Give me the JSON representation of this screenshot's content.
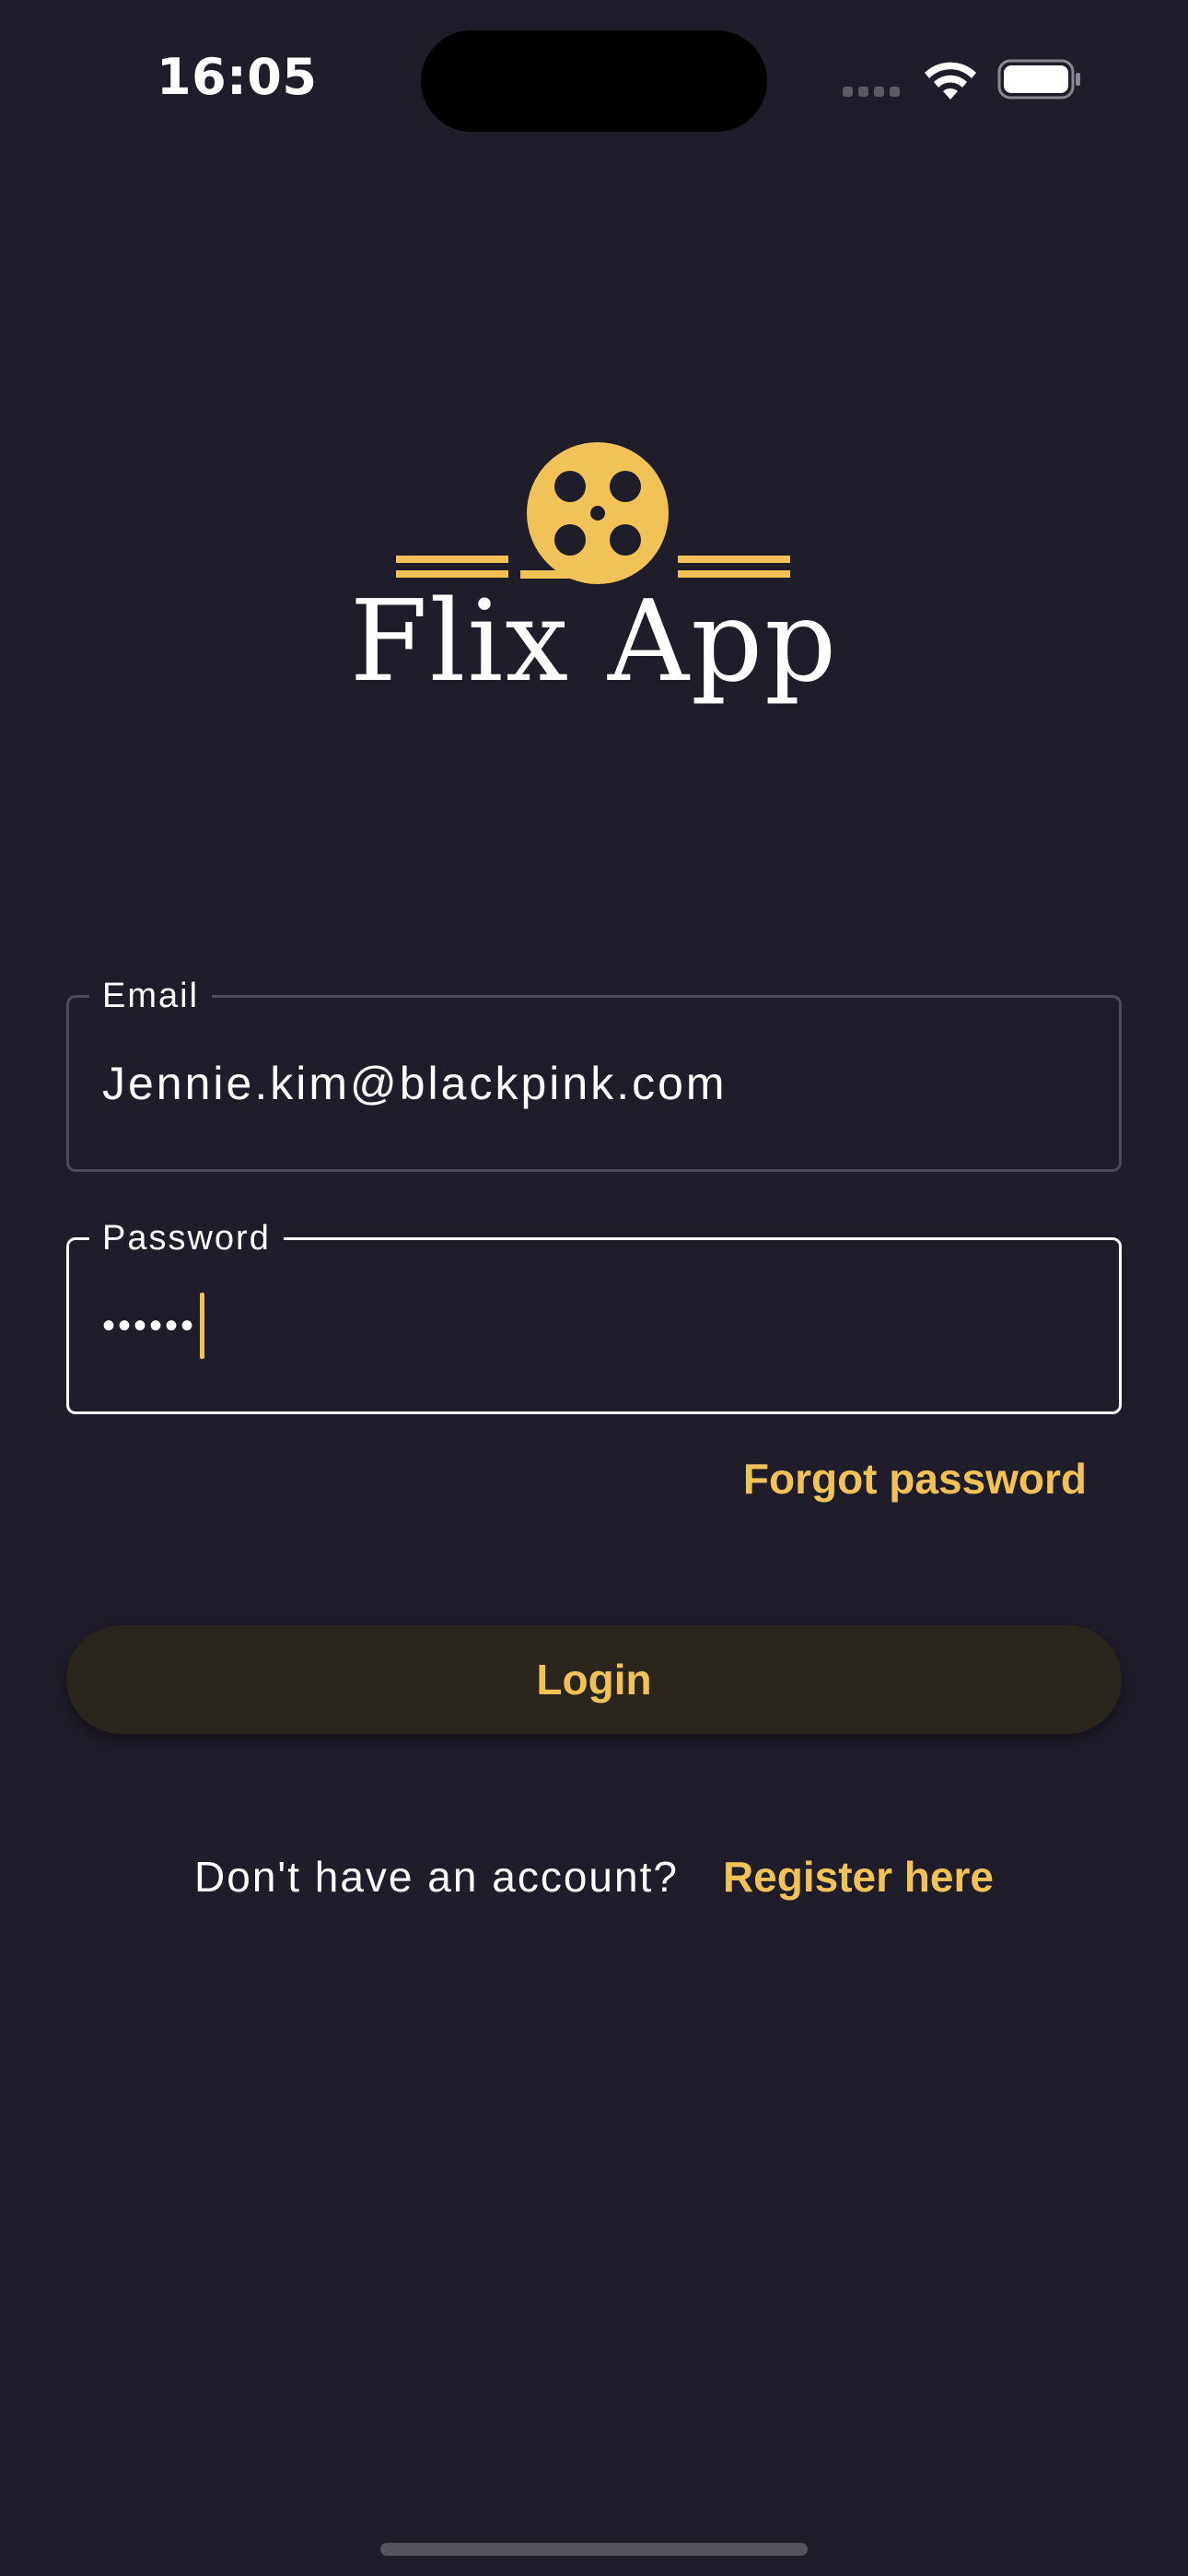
{
  "status_bar": {
    "time": "16:05"
  },
  "brand": {
    "title": "Flix App",
    "logo_icon": "film-reel-icon",
    "accent_color": "#f1c257",
    "background_color": "#1f1d2a"
  },
  "form": {
    "email": {
      "label": "Email",
      "value": "Jennie.kim@blackpink.com"
    },
    "password": {
      "label": "Password",
      "masked_value": "••••••"
    },
    "forgot_password": "Forgot password",
    "login_button": "Login"
  },
  "register": {
    "prompt": "Don't have an account?",
    "link": "Register here"
  }
}
